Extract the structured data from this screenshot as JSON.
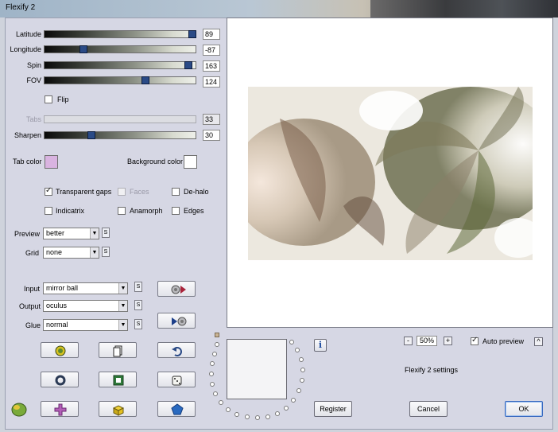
{
  "window": {
    "title": "Flexify 2"
  },
  "sliders": [
    {
      "id": "latitude",
      "label": "Latitude",
      "value": "89",
      "level": 0.98,
      "enabled": true
    },
    {
      "id": "longitude",
      "label": "Longitude",
      "value": "-87",
      "level": 0.26,
      "enabled": true
    },
    {
      "id": "spin",
      "label": "Spin",
      "value": "163",
      "level": 0.95,
      "enabled": true
    },
    {
      "id": "fov",
      "label": "FOV",
      "value": "124",
      "level": 0.67,
      "enabled": true
    }
  ],
  "flip": {
    "label": "Flip",
    "checked": false
  },
  "tabs": {
    "label": "Tabs",
    "value": "33",
    "enabled": false
  },
  "sharpen": {
    "label": "Sharpen",
    "value": "30",
    "level": 0.31
  },
  "tab_color": {
    "label": "Tab color",
    "color": "#d9b3e0"
  },
  "background_color": {
    "label": "Background color",
    "color": "#ffffff"
  },
  "options": {
    "transparent_gaps": {
      "label": "Transparent gaps",
      "checked": true
    },
    "faces": {
      "label": "Faces",
      "checked": false,
      "enabled": false
    },
    "de_halo": {
      "label": "De-halo",
      "checked": false
    },
    "indicatrix": {
      "label": "Indicatrix",
      "checked": false
    },
    "anamorph": {
      "label": "Anamorph",
      "checked": false
    },
    "edges": {
      "label": "Edges",
      "checked": false
    }
  },
  "preview_quality": {
    "label": "Preview",
    "value": "better"
  },
  "grid": {
    "label": "Grid",
    "value": "none"
  },
  "input": {
    "label": "Input",
    "value": "mirror ball"
  },
  "output": {
    "label": "Output",
    "value": "oculus"
  },
  "glue": {
    "label": "Glue",
    "value": "normal"
  },
  "s_label": "S",
  "info_label": "i",
  "zoom": {
    "minus": "-",
    "value": "50%",
    "plus": "+"
  },
  "auto_preview": {
    "label": "Auto preview",
    "checked": true,
    "caret": "^"
  },
  "settings_label": "Flexify 2 settings",
  "buttons": {
    "register": "Register",
    "cancel": "Cancel",
    "ok": "OK"
  },
  "icons": {
    "swap_input": "mirror-ball-to-oculus-icon",
    "swap_output": "oculus-to-mirror-ball-icon",
    "randomize": "dice-icon"
  },
  "colors": {
    "panel": "#d6d7e4",
    "slider_thumb": "#2a4a86",
    "accent": "#3a6ac0"
  }
}
